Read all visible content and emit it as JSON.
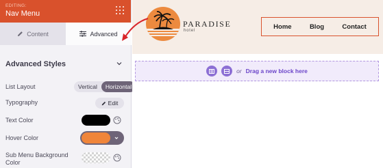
{
  "panel": {
    "editing_label": "EDITING:",
    "title": "Nav Menu",
    "header_color": "#d9512c",
    "grid_icon": "drag-grid-icon",
    "tabs": [
      {
        "label": "Content",
        "icon": "pencil-icon",
        "active": false
      },
      {
        "label": "Advanced",
        "icon": "sliders-icon",
        "active": true
      }
    ],
    "section_title": "Advanced Styles",
    "list_layout": {
      "label": "List Layout",
      "options": [
        "Vertical",
        "Horizontal"
      ],
      "selected": "Horizontal"
    },
    "typography": {
      "label": "Typography",
      "button": "Edit"
    },
    "text_color": {
      "label": "Text Color",
      "value": "#000000"
    },
    "hover_color": {
      "label": "Hover Color",
      "value": "#f0853a"
    },
    "submenu_bg": {
      "label": "Sub Menu Background Color",
      "value": "transparent"
    }
  },
  "preview": {
    "logo_name": "PARADISE",
    "logo_sub": "hotel",
    "nav_links": [
      "Home",
      "Blog",
      "Contact"
    ],
    "nav_border_color": "#d9512c",
    "drop_zone": {
      "or_text": "or",
      "cta": "Drag a new block here"
    }
  }
}
